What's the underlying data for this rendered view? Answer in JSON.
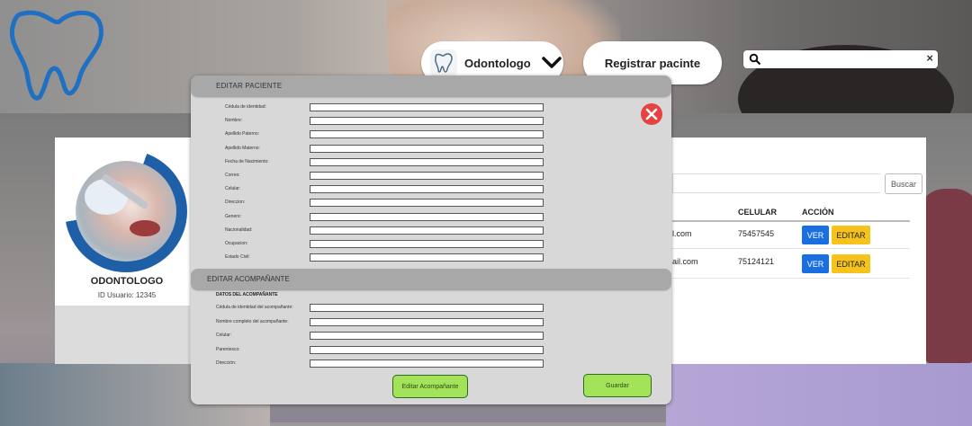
{
  "colors": {
    "brand_blue": "#1f6fc2",
    "primary_button": "#1a6fe0",
    "warning_button": "#f5c31c",
    "success_button": "#a2e35a",
    "close_button": "#e74141",
    "modal_bg": "#d8d8d8",
    "modal_header": "#a8a8a8"
  },
  "header": {
    "role_menu": {
      "label": "Odontologo",
      "icon": "tooth-icon",
      "dropdown_icon": "chevron-down-icon"
    },
    "register_button": "Registrar pacinte",
    "search": {
      "placeholder": "",
      "icon": "search-icon",
      "clear_icon": "close-icon"
    }
  },
  "profile": {
    "role": "ODONTOLOGO",
    "user_id": "ID Usuario: 12345"
  },
  "table": {
    "search_button": "Buscar",
    "columns": [
      "CELULAR",
      "ACCIÓN"
    ],
    "rows": [
      {
        "email_fragment": "l.com",
        "phone": "75457545",
        "view": "VER",
        "edit": "EDITAR"
      },
      {
        "email_fragment": "ail.com",
        "phone": "75124121",
        "view": "VER",
        "edit": "EDITAR"
      }
    ]
  },
  "modal": {
    "title": "EDITAR  PACIENTE",
    "close_icon": "close-icon",
    "patient_fields": [
      "Cédula de identidad:",
      "Nombre:",
      "Apellido Paterno:",
      "Apellido Materno:",
      "Fecha de Nacimiento:",
      "Correo:",
      "Celular:",
      "Direccion:",
      "Genero:",
      "Nacionalidad:",
      "Ocupacion:",
      "Estado Civil:"
    ],
    "companion_section_title": "EDITAR  ACOMPAÑANTE",
    "companion_subtitle": "DATOS DEL ACOMPAÑANTE",
    "companion_fields": [
      "Cédula de identidad del acompañante:",
      "Nombre completo del acompañante:",
      "Celular:",
      "Parentesco:",
      "Dirección:"
    ],
    "edit_companion_button": "Editar Acompañante",
    "save_button": "Guardar"
  }
}
